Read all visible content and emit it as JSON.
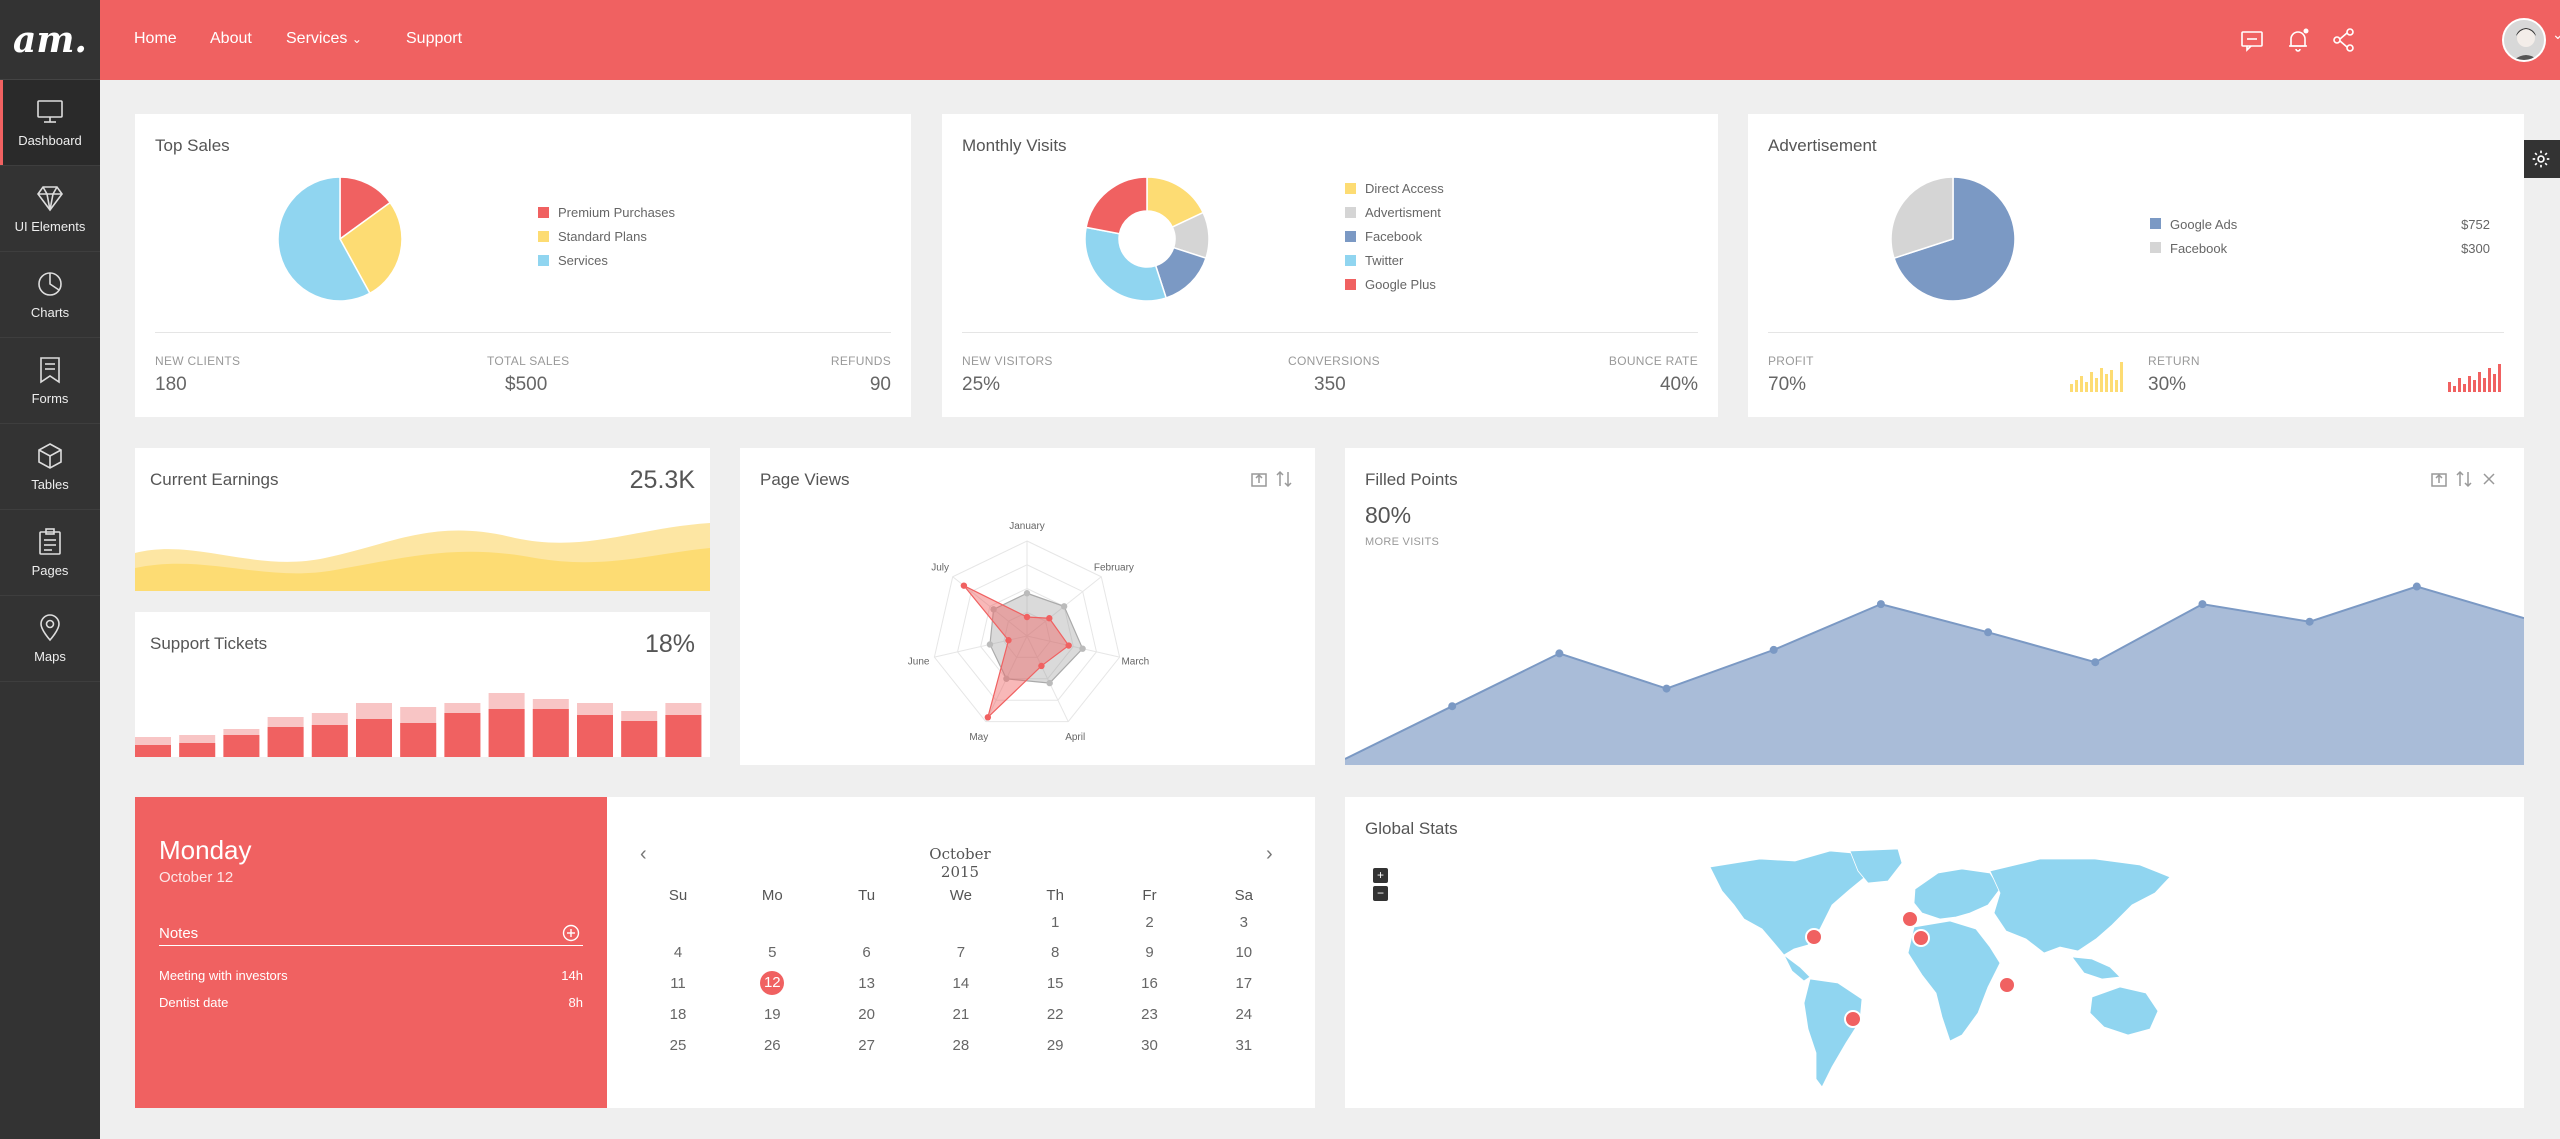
{
  "app": {
    "logo": "am."
  },
  "sidebar": {
    "items": [
      {
        "label": "Dashboard",
        "icon": "monitor-icon",
        "active": true
      },
      {
        "label": "UI Elements",
        "icon": "diamond-icon"
      },
      {
        "label": "Charts",
        "icon": "pie-chart-icon"
      },
      {
        "label": "Forms",
        "icon": "bookmark-icon"
      },
      {
        "label": "Tables",
        "icon": "cube-icon"
      },
      {
        "label": "Pages",
        "icon": "clipboard-icon"
      },
      {
        "label": "Maps",
        "icon": "map-pin-icon"
      }
    ]
  },
  "topnav": {
    "home": "Home",
    "about": "About",
    "services": "Services",
    "support": "Support"
  },
  "top_sales": {
    "title": "Top Sales",
    "legend": [
      "Premium Purchases",
      "Standard Plans",
      "Services"
    ],
    "stats": [
      {
        "label": "NEW CLIENTS",
        "value": "180"
      },
      {
        "label": "TOTAL SALES",
        "value": "$500"
      },
      {
        "label": "REFUNDS",
        "value": "90"
      }
    ]
  },
  "monthly_visits": {
    "title": "Monthly Visits",
    "legend": [
      "Direct Access",
      "Advertisment",
      "Facebook",
      "Twitter",
      "Google Plus"
    ],
    "stats": [
      {
        "label": "NEW VISITORS",
        "value": "25%"
      },
      {
        "label": "CONVERSIONS",
        "value": "350"
      },
      {
        "label": "BOUNCE RATE",
        "value": "40%"
      }
    ]
  },
  "advertisement": {
    "title": "Advertisement",
    "legend": [
      {
        "name": "Google Ads",
        "value": "$752"
      },
      {
        "name": "Facebook",
        "value": "$300"
      }
    ],
    "stats": [
      {
        "label": "PROFIT",
        "value": "70%"
      },
      {
        "label": "RETURN",
        "value": "30%"
      }
    ]
  },
  "current_earnings": {
    "title": "Current Earnings",
    "value": "25.3K"
  },
  "support_tickets": {
    "title": "Support Tickets",
    "value": "18%"
  },
  "page_views": {
    "title": "Page Views",
    "axes": [
      "January",
      "February",
      "March",
      "April",
      "May",
      "June",
      "July"
    ]
  },
  "filled_points": {
    "title": "Filled Points",
    "value": "80%",
    "sublabel": "MORE VISITS"
  },
  "calendar": {
    "day": "Monday",
    "date": "October 12",
    "notes_label": "Notes",
    "notes": [
      {
        "text": "Meeting with investors",
        "time": "14h"
      },
      {
        "text": "Dentist date",
        "time": "8h"
      }
    ],
    "month": "October 2015",
    "weekdays": [
      "Su",
      "Mo",
      "Tu",
      "We",
      "Th",
      "Fr",
      "Sa"
    ],
    "weeks": [
      [
        "",
        "",
        "",
        "",
        "1",
        "2",
        "3"
      ],
      [
        "4",
        "5",
        "6",
        "7",
        "8",
        "9",
        "10"
      ],
      [
        "11",
        "12",
        "13",
        "14",
        "15",
        "16",
        "17"
      ],
      [
        "18",
        "19",
        "20",
        "21",
        "22",
        "23",
        "24"
      ],
      [
        "25",
        "26",
        "27",
        "28",
        "29",
        "30",
        "31"
      ]
    ],
    "selected": "12"
  },
  "global_stats": {
    "title": "Global Stats",
    "zoom_in": "+",
    "zoom_out": "−"
  },
  "colors": {
    "accent": "#f06161",
    "yellow": "#fddc73",
    "blue": "#90d5f0",
    "slate": "#7b99c4",
    "grey": "#d5d5d5"
  },
  "chart_data": [
    {
      "type": "pie",
      "chart": "top_sales",
      "series": [
        {
          "name": "Premium Purchases",
          "value": 15
        },
        {
          "name": "Standard Plans",
          "value": 27
        },
        {
          "name": "Services",
          "value": 58
        }
      ]
    },
    {
      "type": "pie",
      "chart": "monthly_visits",
      "series": [
        {
          "name": "Direct Access",
          "value": 18
        },
        {
          "name": "Advertisment",
          "value": 12
        },
        {
          "name": "Facebook",
          "value": 15
        },
        {
          "name": "Twitter",
          "value": 33
        },
        {
          "name": "Google Plus",
          "value": 22
        }
      ]
    },
    {
      "type": "pie",
      "chart": "advertisement",
      "series": [
        {
          "name": "Google Ads",
          "value": 70
        },
        {
          "name": "Facebook",
          "value": 30
        }
      ]
    },
    {
      "type": "bar",
      "chart": "support_tickets",
      "values": [
        {
          "a": 12,
          "b": 20
        },
        {
          "a": 14,
          "b": 22
        },
        {
          "a": 22,
          "b": 28
        },
        {
          "a": 30,
          "b": 40
        },
        {
          "a": 32,
          "b": 44
        },
        {
          "a": 38,
          "b": 54
        },
        {
          "a": 34,
          "b": 50
        },
        {
          "a": 44,
          "b": 54
        },
        {
          "a": 48,
          "b": 64
        },
        {
          "a": 48,
          "b": 58
        },
        {
          "a": 42,
          "b": 54
        },
        {
          "a": 36,
          "b": 46
        },
        {
          "a": 42,
          "b": 54
        }
      ]
    },
    {
      "type": "radar",
      "chart": "page_views",
      "axes": [
        "January",
        "February",
        "March",
        "April",
        "May",
        "June",
        "July"
      ],
      "series": [
        {
          "values": [
            0.45,
            0.5,
            0.6,
            0.55,
            0.5,
            0.4,
            0.45
          ]
        },
        {
          "values": [
            0.2,
            0.3,
            0.45,
            0.35,
            0.95,
            0.2,
            0.85
          ]
        }
      ]
    },
    {
      "type": "area",
      "chart": "filled_points",
      "values": [
        0,
        30,
        60,
        40,
        62,
        88,
        72,
        55,
        88,
        78,
        98,
        80
      ]
    }
  ]
}
